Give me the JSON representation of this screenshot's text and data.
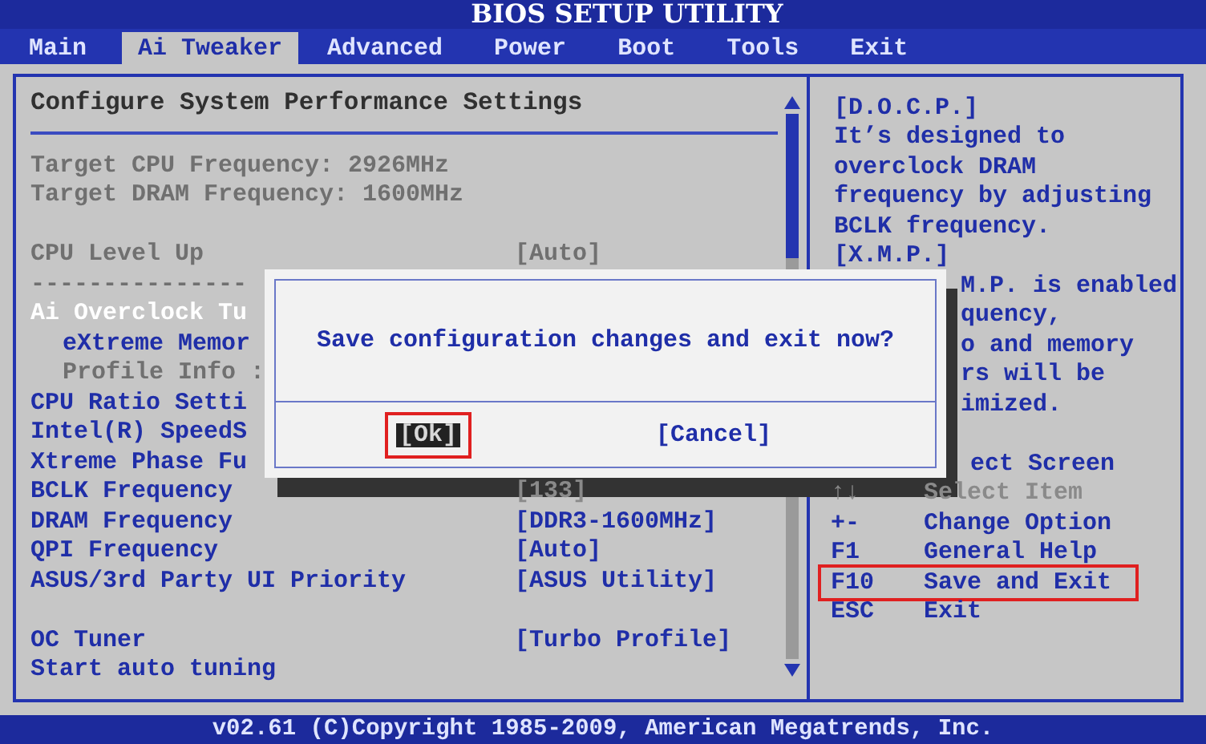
{
  "title": "BIOS SETUP UTILITY",
  "tabs": [
    {
      "label": "Main",
      "selected": false
    },
    {
      "label": "Ai Tweaker",
      "selected": true
    },
    {
      "label": "Advanced",
      "selected": false
    },
    {
      "label": "Power",
      "selected": false
    },
    {
      "label": "Boot",
      "selected": false
    },
    {
      "label": "Tools",
      "selected": false
    },
    {
      "label": "Exit",
      "selected": false
    }
  ],
  "panel": {
    "heading": "Configure System Performance Settings",
    "items": [
      {
        "kind": "info",
        "label": "Target CPU Frequency: 2926MHz"
      },
      {
        "kind": "info",
        "label": "Target DRAM Frequency: 1600MHz"
      },
      {
        "kind": "spacer"
      },
      {
        "kind": "info",
        "label": "CPU Level Up",
        "value": "[Auto]"
      },
      {
        "kind": "separator",
        "label": "---------------"
      },
      {
        "kind": "option",
        "label": "Ai Overclock Tu",
        "selected": true,
        "children": [
          {
            "kind": "option",
            "label": "eXtreme Memor",
            "selected": false
          },
          {
            "kind": "info",
            "label": "Profile Info :"
          }
        ]
      },
      {
        "kind": "option",
        "label": "CPU Ratio Setti",
        "selected": false
      },
      {
        "kind": "option",
        "label": "Intel(R) SpeedS",
        "selected": false
      },
      {
        "kind": "option",
        "label": "Xtreme Phase Fu",
        "selected": false
      },
      {
        "kind": "option",
        "label": "BCLK Frequency",
        "selected": false,
        "value": "[133]",
        "dimmed": true
      },
      {
        "kind": "option",
        "label": "DRAM Frequency",
        "selected": false,
        "value": "[DDR3-1600MHz]",
        "dimmed": false
      },
      {
        "kind": "option",
        "label": "QPI Frequency",
        "selected": false,
        "value": "[Auto]",
        "dimmed": false
      },
      {
        "kind": "option",
        "label": "ASUS/3rd Party UI Priority",
        "selected": false,
        "value": "[ASUS Utility]",
        "dimmed": false
      },
      {
        "kind": "spacer"
      },
      {
        "kind": "option",
        "label": "OC Tuner",
        "selected": false,
        "value": "[Turbo Profile]",
        "dimmed": false
      },
      {
        "kind": "option",
        "label": "Start auto tuning",
        "selected": false
      }
    ]
  },
  "help": {
    "lines": [
      {
        "text": "[D.O.C.P.]"
      },
      {
        "text": "It’s designed to"
      },
      {
        "text": "overclock DRAM"
      },
      {
        "text": "frequency by adjusting"
      },
      {
        "text": "BCLK frequency."
      },
      {
        "text": "[X.M.P.]"
      },
      {
        "text": "M.P. is enabled",
        "clipped": true
      },
      {
        "text": "quency,",
        "clipped": true
      },
      {
        "text": "o and memory",
        "clipped": true
      },
      {
        "text": "rs will be",
        "clipped": true
      },
      {
        "text": "imized.",
        "clipped": true
      }
    ],
    "keys": [
      {
        "action": "ect Screen",
        "clipped": true,
        "dimmed": false,
        "highlighted": false
      },
      {
        "key": "↑↓",
        "action": "Select Item",
        "dimmed": true,
        "highlighted": false
      },
      {
        "key": "+-",
        "action": "Change Option",
        "dimmed": false,
        "highlighted": false
      },
      {
        "key": "F1",
        "action": "General Help",
        "dimmed": false,
        "highlighted": false
      },
      {
        "key": "F10",
        "action": "Save and Exit",
        "dimmed": false,
        "highlighted": true
      },
      {
        "key": "ESC",
        "action": "Exit",
        "dimmed": false,
        "highlighted": false
      }
    ]
  },
  "dialog": {
    "message": "Save configuration changes and exit now?",
    "buttons": [
      {
        "label": "[Ok]",
        "selected": true,
        "highlighted": true
      },
      {
        "label": "[Cancel]",
        "selected": false,
        "highlighted": false
      }
    ]
  },
  "footer": "v02.61 (C)Copyright 1985-2009, American Megatrends, Inc."
}
